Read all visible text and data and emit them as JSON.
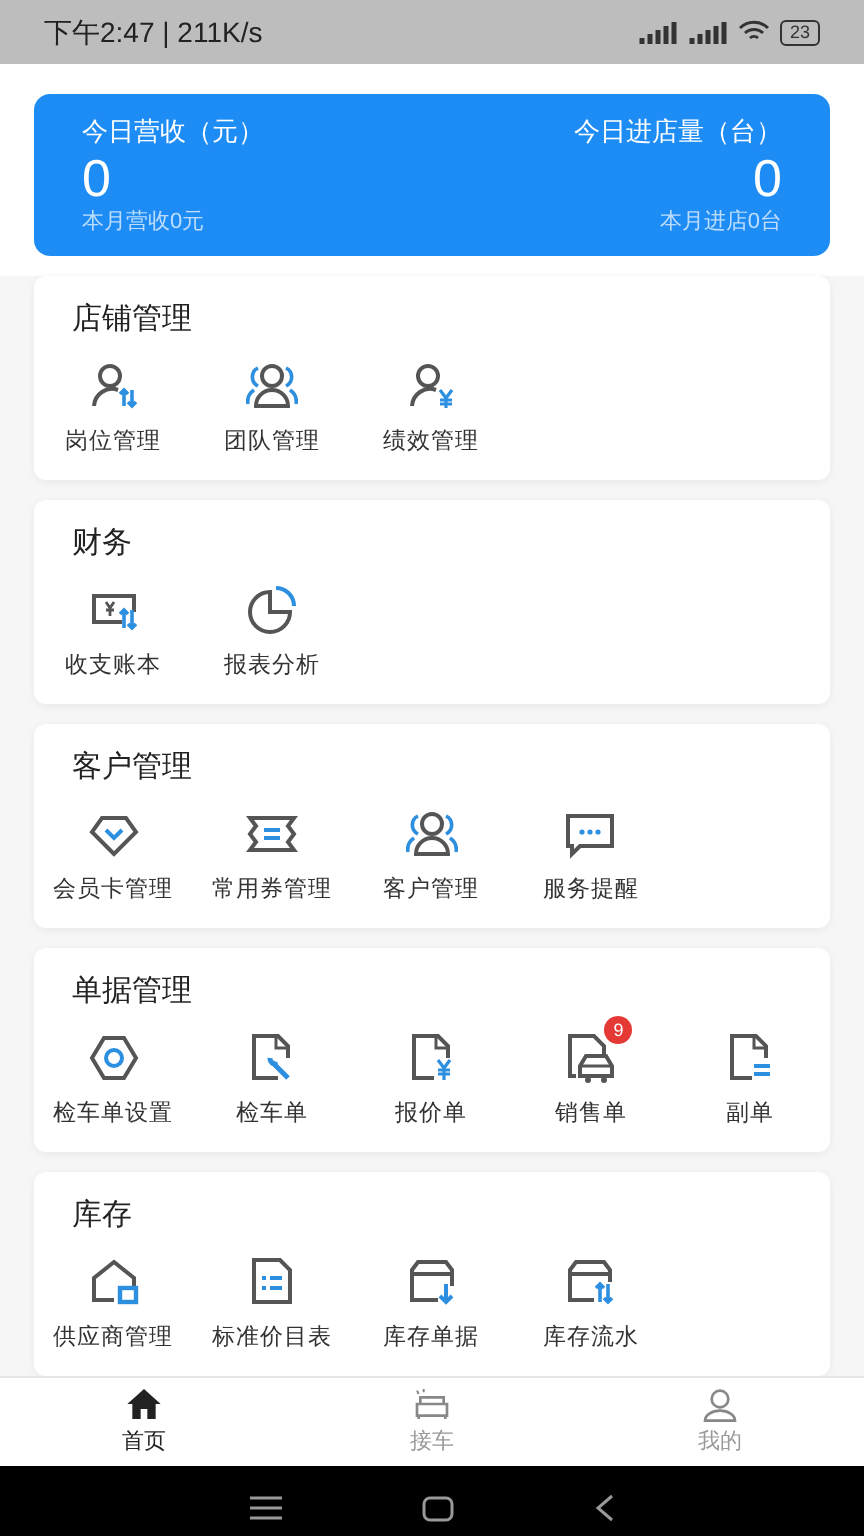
{
  "status_bar": {
    "time_speed": "下午2:47 | 211K/s",
    "battery": "23"
  },
  "summary": {
    "left": {
      "label": "今日营收（元）",
      "value": "0",
      "sub": "本月营收0元"
    },
    "right": {
      "label": "今日进店量（台）",
      "value": "0",
      "sub": "本月进店0台"
    }
  },
  "sections": [
    {
      "title": "店铺管理",
      "items": [
        {
          "label": "岗位管理"
        },
        {
          "label": "团队管理"
        },
        {
          "label": "绩效管理"
        }
      ]
    },
    {
      "title": "财务",
      "items": [
        {
          "label": "收支账本"
        },
        {
          "label": "报表分析"
        }
      ]
    },
    {
      "title": "客户管理",
      "items": [
        {
          "label": "会员卡管理"
        },
        {
          "label": "常用券管理"
        },
        {
          "label": "客户管理"
        },
        {
          "label": "服务提醒"
        }
      ]
    },
    {
      "title": "单据管理",
      "items": [
        {
          "label": "检车单设置"
        },
        {
          "label": "检车单"
        },
        {
          "label": "报价单"
        },
        {
          "label": "销售单",
          "badge": "9"
        },
        {
          "label": "副单"
        }
      ]
    },
    {
      "title": "库存",
      "items": [
        {
          "label": "供应商管理"
        },
        {
          "label": "标准价目表"
        },
        {
          "label": "库存单据"
        },
        {
          "label": "库存流水"
        }
      ]
    }
  ],
  "tabs": [
    {
      "label": "首页",
      "selected": true
    },
    {
      "label": "接车",
      "selected": false
    },
    {
      "label": "我的",
      "selected": false
    }
  ]
}
